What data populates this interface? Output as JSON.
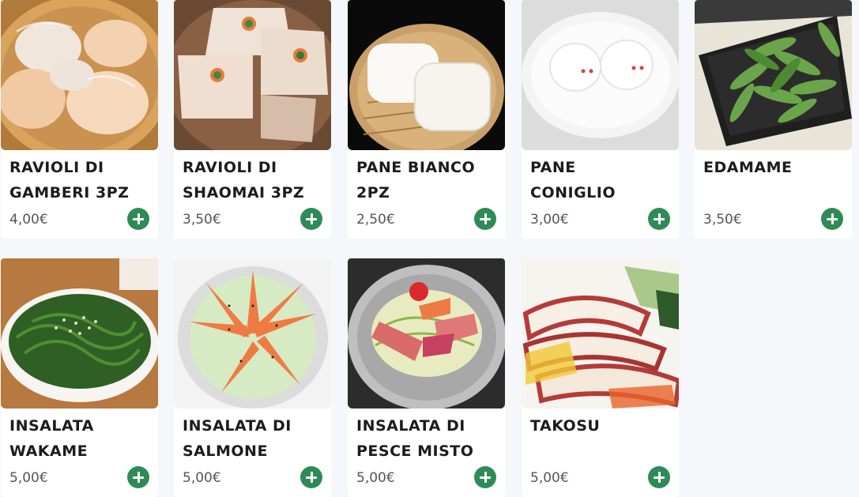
{
  "menu": {
    "items": [
      {
        "name": "RAVIOLI DI\nGAMBERI 3PZ",
        "price": "4,00€",
        "image_icon": "shrimp-dumplings-image"
      },
      {
        "name": "RAVIOLI DI\nSHAOMAI 3PZ",
        "price": "3,50€",
        "image_icon": "shaomai-dumplings-image"
      },
      {
        "name": "PANE BIANCO\n2PZ",
        "price": "2,50€",
        "image_icon": "steamed-white-buns-image"
      },
      {
        "name": "PANE\nCONIGLIO",
        "price": "3,00€",
        "image_icon": "rabbit-buns-image"
      },
      {
        "name": "EDAMAME",
        "price": "3,50€",
        "image_icon": "edamame-image"
      },
      {
        "name": "INSALATA\nWAKAME",
        "price": "5,00€",
        "image_icon": "wakame-salad-image"
      },
      {
        "name": "INSALATA DI\nSALMONE",
        "price": "5,00€",
        "image_icon": "salmon-salad-image"
      },
      {
        "name": "INSALATA DI\nPESCE MISTO",
        "price": "5,00€",
        "image_icon": "mixed-fish-salad-image"
      },
      {
        "name": "TAKOSU",
        "price": "5,00€",
        "image_icon": "takosu-image"
      }
    ]
  },
  "colors": {
    "background": "#f5f7fa",
    "card": "#ffffff",
    "add_button": "#2e8b57",
    "title_text": "#1c1c1c",
    "price_text": "#555555"
  }
}
